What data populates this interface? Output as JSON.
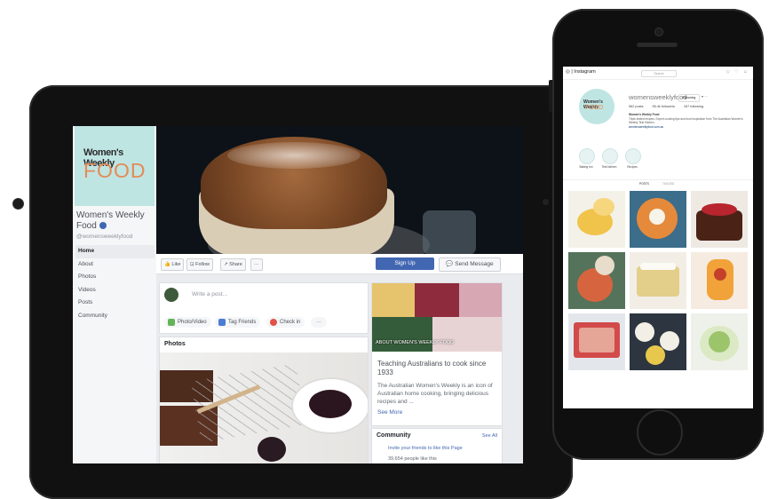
{
  "facebook": {
    "logo_line1": "Women's Weekly",
    "logo_line2": "FOOD",
    "page_name": "Women's Weekly Food",
    "handle": "@womensweeklyfood",
    "nav": [
      "Home",
      "About",
      "Photos",
      "Videos",
      "Posts",
      "Community"
    ],
    "actions": {
      "like": "Like",
      "follow": "Follow",
      "share": "Share",
      "more": "···"
    },
    "sign_up": "Sign Up",
    "send_message": "Send Message",
    "composer": {
      "placeholder": "Write a post...",
      "photo_video": "Photo/Video",
      "tag_friends": "Tag Friends",
      "check_in": "Check in",
      "more": "···"
    },
    "photos_header": "Photos",
    "about": {
      "image_caption": "ABOUT WOMEN'S WEEKLY FOOD",
      "title": "Teaching Australians to cook since 1933",
      "description": "The Australian Women's Weekly is an icon of Australian home cooking, bringing delicious recipes and ...",
      "see_more": "See More"
    },
    "community": {
      "header": "Community",
      "see_all": "See All",
      "invite": "Invite your friends to like this Page",
      "likes": "39,654 people like this"
    }
  },
  "instagram": {
    "logo": "Instagram",
    "search": "Search",
    "avatar_line1": "Women's Weekly",
    "avatar_line2": "FOOD",
    "username": "womensweeklyfood",
    "follow": "Following",
    "stats": [
      "962 posts",
      "55.4k followers",
      "167 following"
    ],
    "bio_name": "Women's Weekly Food",
    "bio_text": "Triple-tested recipes. Expert cooking tips and food inspiration from The Australian Women's Weekly Test Kitchen.",
    "bio_link": "womensweeklyfood.com.au",
    "highlights": [
      "Baking fun",
      "Test kitchen",
      "Recipes"
    ],
    "tabs": [
      "POSTS",
      "TAGGED"
    ]
  }
}
